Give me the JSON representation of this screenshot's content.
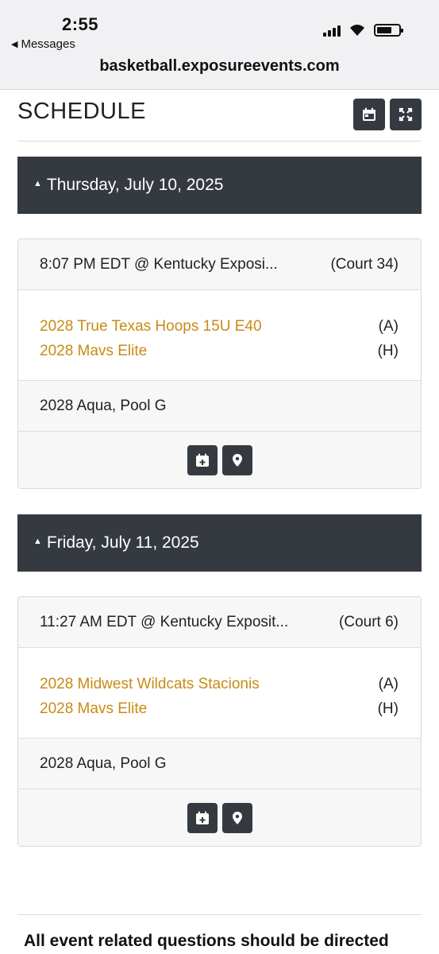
{
  "status": {
    "time": "2:55",
    "back_label": "Messages"
  },
  "browser": {
    "url": "basketball.exposureevents.com"
  },
  "schedule": {
    "title": "SCHEDULE",
    "days": [
      {
        "date": "Thursday, July 10, 2025",
        "game": {
          "time_location": "8:07 PM EDT @ Kentucky Exposi...",
          "court": "(Court 34)",
          "away_team": "2028 True Texas Hoops 15U E40",
          "away_marker": "(A)",
          "home_team": "2028 Mavs Elite",
          "home_marker": "(H)",
          "division": "2028 Aqua, Pool G"
        }
      },
      {
        "date": "Friday, July 11, 2025",
        "game": {
          "time_location": "11:27 AM EDT @ Kentucky Exposit...",
          "court": "(Court 6)",
          "away_team": "2028 Midwest Wildcats Stacionis",
          "away_marker": "(A)",
          "home_team": "2028 Mavs Elite",
          "home_marker": "(H)",
          "division": "2028 Aqua, Pool G"
        }
      }
    ]
  },
  "footer": {
    "text": "All event related questions should be directed"
  },
  "colors": {
    "dark": "#343a40",
    "team_link": "#c98a14",
    "card_bg": "#f7f7f7"
  }
}
